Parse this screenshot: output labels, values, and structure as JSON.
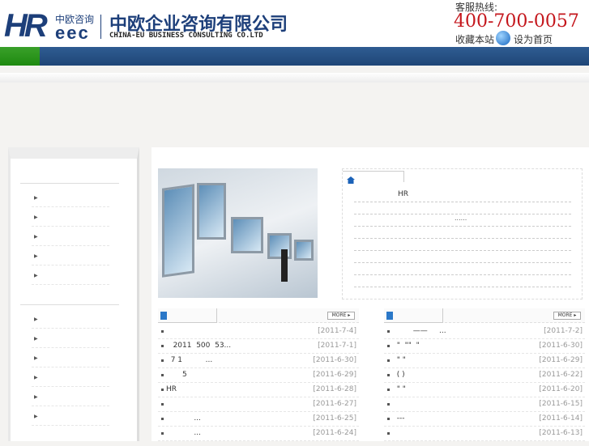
{
  "header": {
    "logo_hr": "HR",
    "logo_small": "中欧咨询",
    "logo_eec": "eec",
    "company_cn": "中欧企业咨询有限公司",
    "company_en": "CHINA-EU BUSINESS CONSULTING CO.LTD",
    "hotline_label": "客服热线:",
    "hotline": "400-700-0057",
    "favorite": "收藏本站",
    "set_home": "设为首页"
  },
  "intro": {
    "line1": "HR",
    "line2": "......"
  },
  "news_left": {
    "more": "MORE ▸",
    "items": [
      {
        "title": "",
        "date": "[2011-7-4]"
      },
      {
        "title": "   2011  500  53...",
        "date": "[2011-7-1]"
      },
      {
        "title": "  7 1          ...",
        "date": "[2011-6-30]"
      },
      {
        "title": "       5",
        "date": "[2011-6-29]"
      },
      {
        "title": "HR",
        "date": "[2011-6-28]"
      },
      {
        "title": "",
        "date": "[2011-6-27]"
      },
      {
        "title": "            ...",
        "date": "[2011-6-25]"
      },
      {
        "title": "            ...",
        "date": "[2011-6-24]"
      }
    ]
  },
  "news_right": {
    "more": "MORE ▸",
    "items": [
      {
        "title": "         ——     ...",
        "date": "[2011-7-2]"
      },
      {
        "title": "  \"  \"\"  \"",
        "date": "[2011-6-30]"
      },
      {
        "title": "  \" \"",
        "date": "[2011-6-29]"
      },
      {
        "title": "  ( )",
        "date": "[2011-6-22]"
      },
      {
        "title": "  \" \"",
        "date": "[2011-6-20]"
      },
      {
        "title": "",
        "date": "[2011-6-15]"
      },
      {
        "title": "  ---",
        "date": "[2011-6-14]"
      },
      {
        "title": "",
        "date": "[2011-6-13]"
      }
    ]
  }
}
